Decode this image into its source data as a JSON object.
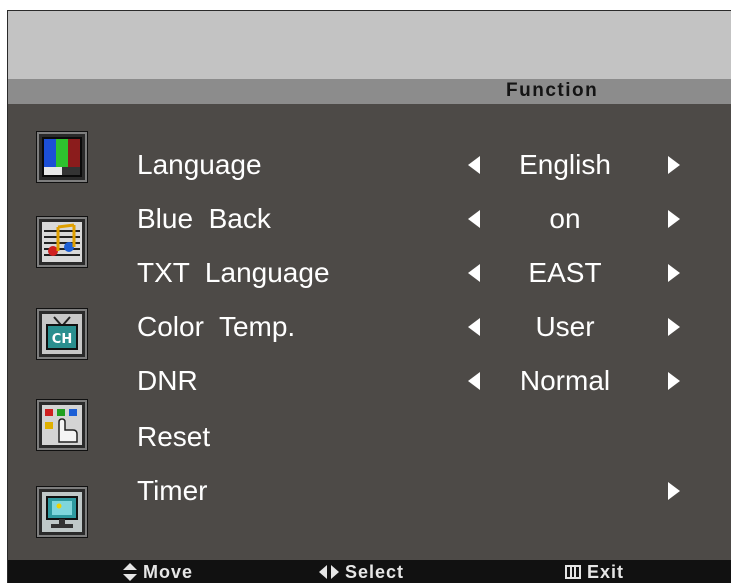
{
  "menu": {
    "title": "Function",
    "items": [
      {
        "label": "Language",
        "value": "English"
      },
      {
        "label": "Blue  Back",
        "value": "on"
      },
      {
        "label": "TXT  Language",
        "value": "EAST"
      },
      {
        "label": "Color  Temp.",
        "value": "User"
      },
      {
        "label": "DNR",
        "value": "Normal"
      },
      {
        "label": "Reset",
        "value": ""
      },
      {
        "label": "Timer",
        "value": ""
      }
    ]
  },
  "sidebar_icons": [
    {
      "name": "picture-icon"
    },
    {
      "name": "sound-icon"
    },
    {
      "name": "channel-icon"
    },
    {
      "name": "function-icon"
    },
    {
      "name": "timer-icon"
    }
  ],
  "footer": {
    "move_label": "Move",
    "select_label": "Select",
    "exit_label": "Exit"
  },
  "colors": {
    "panel": "#4d4a47",
    "top_band": "#c3c3c3",
    "title_bar": "#8c8c8c",
    "footer": "#111111",
    "text": "#ffffff"
  }
}
